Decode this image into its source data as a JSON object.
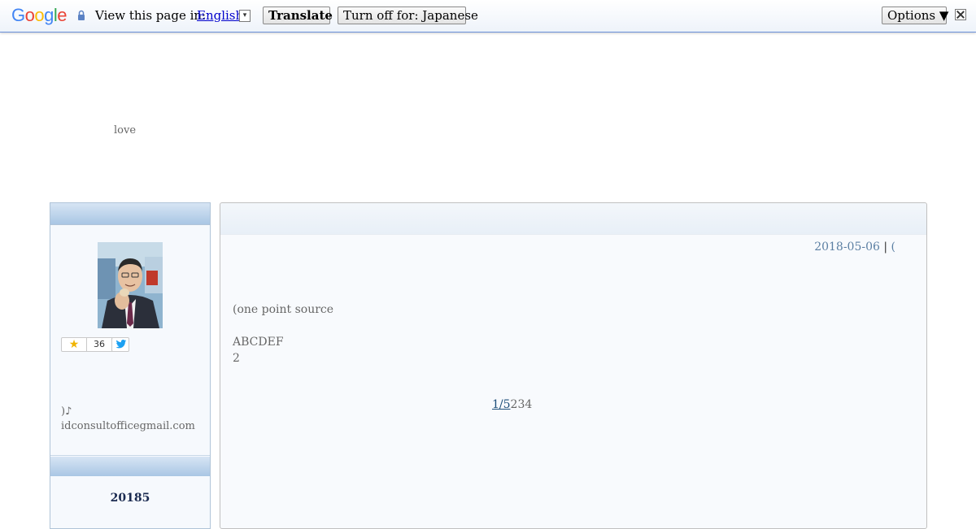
{
  "translate_bar": {
    "logo_text": "Google",
    "prompt": "View this page in:",
    "language": "English",
    "language_arrow": "▾",
    "translate_label": "Translate",
    "turn_off_label": "Turn off for: Japanese",
    "options_label": "Options ▼",
    "colors": {
      "blue": "#4285f4",
      "red": "#ea4335",
      "yellow": "#fbbc05",
      "green": "#34a853"
    }
  },
  "header": {
    "tagline": "love"
  },
  "sidebar": {
    "star_count": "36",
    "profile_line1": ")♪",
    "profile_line2": "idconsultofficegmail.com",
    "calendar_title": "20185"
  },
  "post": {
    "date": "2018-05-06",
    "separator": "|",
    "meta_tail": "(",
    "body_line1": "(one point source",
    "body_line2": "ABCDEF",
    "body_line3": "2",
    "pager_current": "1/5",
    "pager_rest": "234"
  }
}
